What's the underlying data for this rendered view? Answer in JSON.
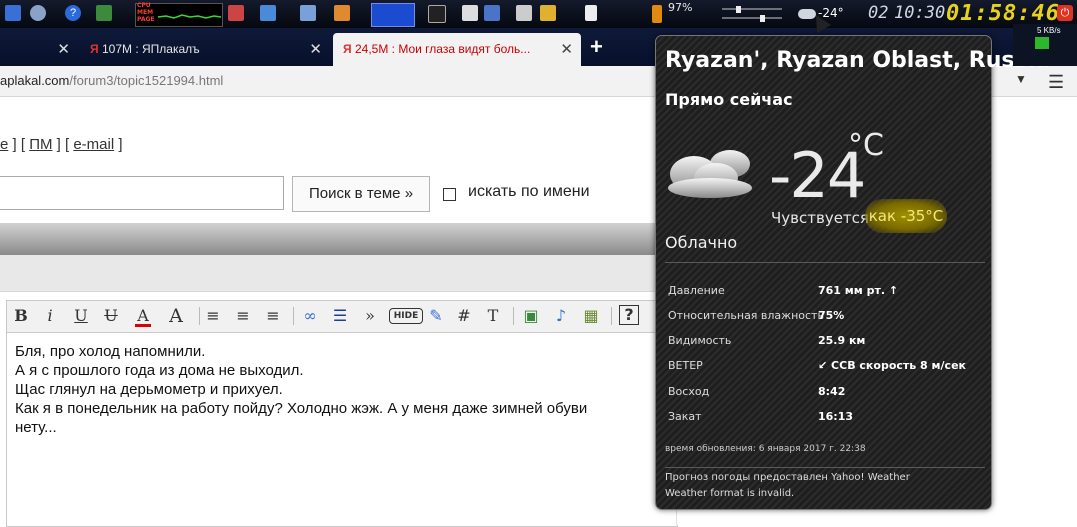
{
  "taskbar": {
    "net_labels": [
      "CPU",
      "MEM",
      "PAGE"
    ],
    "battery": "97%",
    "weather_temp": "-24°",
    "date": "02",
    "time_small": "10:30",
    "clock": "01:58:46",
    "net_speed": "5 KB/s"
  },
  "tabs": [
    {
      "title": "107M : ЯПлакалъ"
    },
    {
      "title": "24,5M : Мои глаза видят боль..."
    }
  ],
  "address": {
    "host": "aplakal.com",
    "path": "/forum3/topic1521994.html"
  },
  "page": {
    "links": [
      "e",
      "ПМ",
      "e-mail"
    ],
    "search_button": "Поиск в теме »",
    "search_by_name": "искать по имени"
  },
  "editor": {
    "toolbar": [
      "B",
      "i",
      "U",
      "U",
      "A",
      "A",
      "≡",
      "≡",
      "≡",
      "∞",
      "☰",
      "»",
      "HIDE",
      "✎",
      "#",
      "T",
      "▣",
      "♪",
      "▦",
      "?"
    ],
    "lines": [
      "Бля, про холод напомнили.",
      "А я с прошлого года из дома не выходил.",
      "Щас глянул на дерьмометр и прихуел.",
      "Как я в понедельник на работу пойду? Холодно жэж. А у меня даже зимней обуви",
      "нету..."
    ]
  },
  "weather": {
    "location": "Ryazan', Ryazan Oblast, Russia",
    "now_label": "Прямо сейчас",
    "temp": "-24",
    "unit": "°C",
    "feels_label": "Чувствуется",
    "feels_value": "как -35°C",
    "condition": "Облачно",
    "details": [
      {
        "label": "Давление",
        "value": "761 мм рт. ↑"
      },
      {
        "label": "Относительная влажность",
        "value": "75%"
      },
      {
        "label": "Видимость",
        "value": "25.9 км"
      },
      {
        "label": "ВЕТЕР",
        "value": "↙ ССВ скорость 8 м/сек"
      },
      {
        "label": "Восход",
        "value": "8:42"
      },
      {
        "label": "Закат",
        "value": "16:13"
      }
    ],
    "updated": "время обновления: 6 января 2017 г. 22:38",
    "credit": "Прогноз погоды предоставлен Yahoo! Weather",
    "error": "Weather format is invalid."
  }
}
